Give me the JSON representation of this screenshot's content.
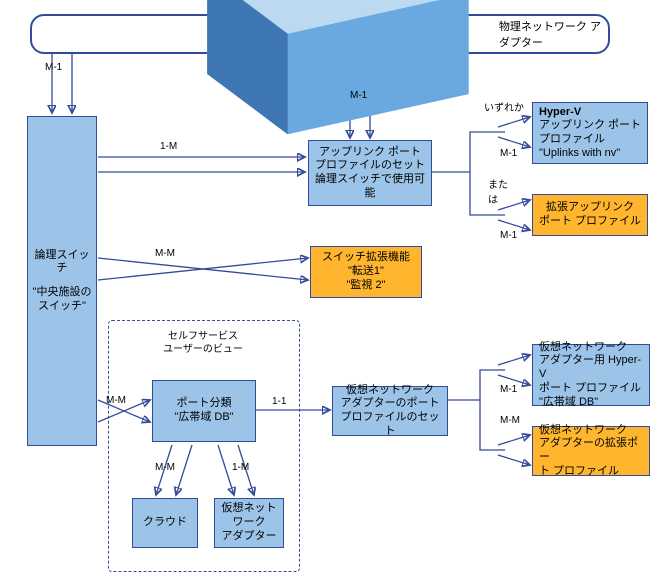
{
  "title": "物理ネットワーク アダプター",
  "logical_switch": {
    "l1": "論理スイッチ",
    "l2": "\"中央施設のスイッチ\""
  },
  "uplink_set": {
    "l1": "アップリンク ポート",
    "l2": "プロファイルのセット",
    "l3": "論理スイッチで使用可",
    "l4": "能"
  },
  "hv_uplink": {
    "l1": "Hyper-V",
    "l2": "アップリンク ポート",
    "l3": "プロファイル",
    "l4": "\"Uplinks with nv\""
  },
  "ext_uplink": {
    "l1": "拡張アップリンク\nポート プロファイル"
  },
  "switch_ext": {
    "l1": "スイッチ拡張機能",
    "l2": "\"転送1\"",
    "l3": "\"監視 2\""
  },
  "port_class": {
    "l1": "ポート分類",
    "l2": "\"広帯域 DB\""
  },
  "vna_set": {
    "l1": "仮想ネットワーク",
    "l2": "アダプターのポート",
    "l3": "プロファイルのセット"
  },
  "hv_vport": {
    "l1": "仮想ネットワーク",
    "l2": "アダプター用 Hyper-V",
    "l3": "ポート プロファイル",
    "l4": "\"広帯域 DB\""
  },
  "ext_vport": {
    "l1": "仮想ネットワーク",
    "l2": "アダプターの拡張ポー",
    "l3": "ト プロファイル"
  },
  "cloud": "クラウド",
  "vna": {
    "l1": "仮想ネット",
    "l2": "ワーク",
    "l3": "アダプター"
  },
  "selfservice": {
    "l1": "セルフサービス",
    "l2": "ユーザーのビュー"
  },
  "lbl": {
    "m1_left": "M-1",
    "m1_center": "M-1",
    "one_m": "1-M",
    "mm_ext": "M-M",
    "mm_port": "M-M",
    "one_one": "1-1",
    "mm_cloud": "M-M",
    "one_m_vna": "1-M",
    "either": "いずれか",
    "or": "または",
    "m1_hv": "M-1",
    "m1_ext": "M-1",
    "m1_hv_v": "M-1",
    "mm_ext_v": "M-M"
  }
}
